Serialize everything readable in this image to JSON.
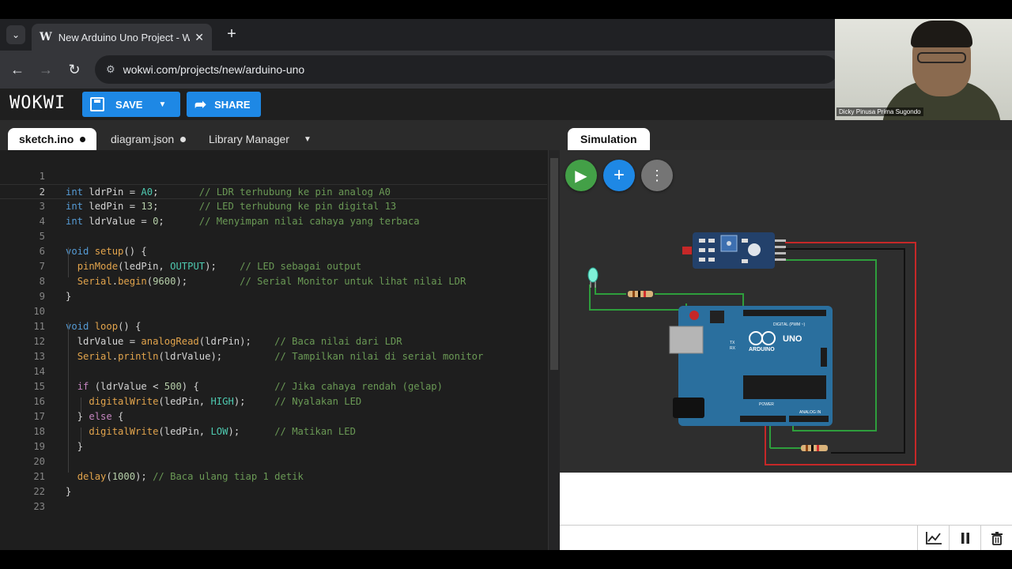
{
  "browser": {
    "tab_title": "New Arduino Uno Project - Wokwi",
    "favicon": "W",
    "close_glyph": "✕",
    "newtab_glyph": "+",
    "menu_glyph": "⌄",
    "url": "wokwi.com/projects/new/arduino-uno",
    "back_glyph": "←",
    "forward_glyph": "→",
    "reload_glyph": "↻",
    "site_info_glyph": "⚙"
  },
  "header": {
    "logo": "WOKWI",
    "save_label": "SAVE",
    "share_label": "SHARE",
    "dropdown_glyph": "▼",
    "share_glyph": "➦",
    "accent": "#1e88e5"
  },
  "webcam": {
    "name": "Dicky Pinusa Prima Sugondo"
  },
  "editor": {
    "tabs": [
      {
        "label": "sketch.ino",
        "dirty": true
      },
      {
        "label": "diagram.json",
        "dirty": true
      },
      {
        "label": "Library Manager",
        "caret": "▼"
      }
    ],
    "line_numbers": [
      "1",
      "2",
      "3",
      "4",
      "5",
      "6",
      "7",
      "8",
      "9",
      "10",
      "11",
      "12",
      "13",
      "14",
      "15",
      "16",
      "17",
      "18",
      "19",
      "20",
      "21",
      "22",
      "23"
    ],
    "lines": [
      "",
      "int ldrPin = A0;       // LDR terhubung ke pin analog A0",
      "int ledPin = 13;       // LED terhubung ke pin digital 13",
      "int ldrValue = 0;      // Menyimpan nilai cahaya yang terbaca",
      "",
      "void setup() {",
      "  pinMode(ledPin, OUTPUT);    // LED sebagai output",
      "  Serial.begin(9600);         // Serial Monitor untuk lihat nilai LDR",
      "}",
      "",
      "void loop() {",
      "  ldrValue = analogRead(ldrPin);    // Baca nilai dari LDR",
      "  Serial.println(ldrValue);         // Tampilkan nilai di serial monitor",
      "",
      "  if (ldrValue < 500) {             // Jika cahaya rendah (gelap)",
      "    digitalWrite(ledPin, HIGH);     // Nyalakan LED",
      "  } else {",
      "    digitalWrite(ledPin, LOW);      // Matikan LED",
      "  }",
      "",
      "  delay(1000); // Baca ulang tiap 1 detik",
      "}",
      ""
    ],
    "current_line": 2
  },
  "simulation": {
    "tab_label": "Simulation",
    "play_glyph": "▶",
    "add_glyph": "+",
    "more_glyph": "⋮",
    "board_brand": "ARDUINO",
    "board_model": "UNO",
    "digital_label": "DIGITAL (PWM ~)",
    "analog_label": "ANALOG IN",
    "power_label": "POWER",
    "tx_label": "TX",
    "rx_label": "RX"
  },
  "serial_monitor": {
    "chart_glyph": "📈",
    "pause_glyph": "⏸",
    "clear_glyph": "🗑"
  },
  "colors": {
    "wire_green": "#2e9e3c",
    "wire_red": "#c62828",
    "wire_black": "#111111",
    "board_blue": "#2a6f9e",
    "play_green": "#43a047"
  }
}
